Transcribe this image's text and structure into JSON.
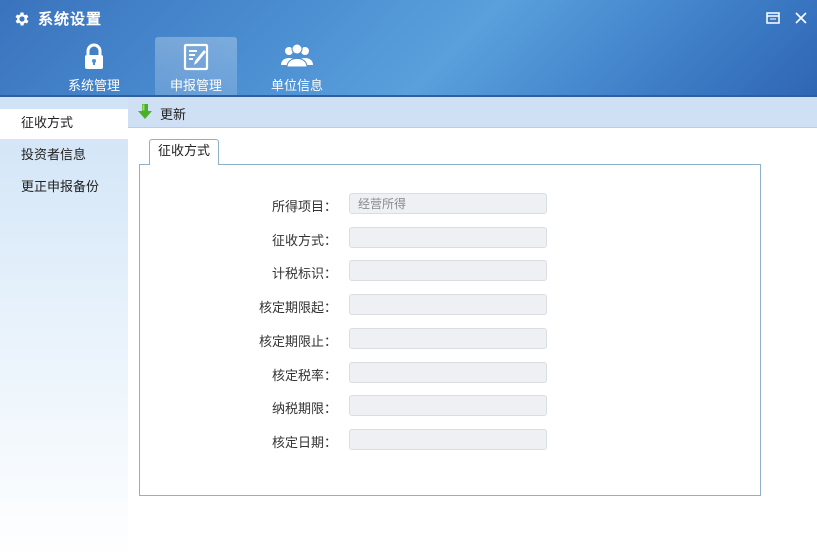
{
  "window": {
    "title": "系统设置"
  },
  "nav": {
    "tabs": [
      {
        "label": "系统管理",
        "icon": "lock-icon"
      },
      {
        "label": "申报管理",
        "icon": "edit-document-icon"
      },
      {
        "label": "单位信息",
        "icon": "users-icon"
      }
    ],
    "active_index": 1
  },
  "sidebar": {
    "items": [
      {
        "label": "征收方式"
      },
      {
        "label": "投资者信息"
      },
      {
        "label": "更正申报备份"
      }
    ],
    "active_index": 0
  },
  "toolbar": {
    "refresh_label": "更新",
    "refresh_icon": "download-arrow-icon"
  },
  "content_tab": {
    "label": "征收方式"
  },
  "form": {
    "fields": [
      {
        "label": "所得项目：",
        "value": "经营所得"
      },
      {
        "label": "征收方式：",
        "value": ""
      },
      {
        "label": "计税标识：",
        "value": ""
      },
      {
        "label": "核定期限起：",
        "value": ""
      },
      {
        "label": "核定期限止：",
        "value": ""
      },
      {
        "label": "核定税率：",
        "value": ""
      },
      {
        "label": "纳税期限：",
        "value": ""
      },
      {
        "label": "核定日期：",
        "value": ""
      }
    ]
  },
  "colors": {
    "header_blue": "#4c8fd2",
    "sidebar_light": "#cfe3f6",
    "toolbar_bg": "#cfe0f4",
    "panel_border": "#8fb0c9",
    "input_bg": "#eef0f3",
    "refresh_icon_green": "#4caf2a"
  }
}
